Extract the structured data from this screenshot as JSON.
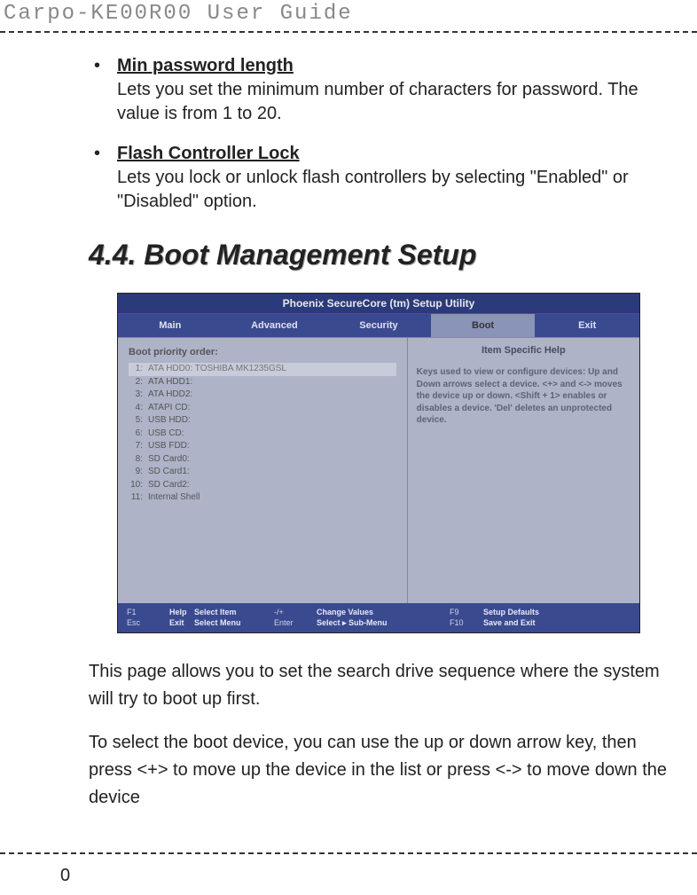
{
  "header": {
    "title": "Carpo-KE00R00 User Guide"
  },
  "bullets": [
    {
      "title": "Min password length",
      "desc": "Lets you set the minimum number of characters for password. The value is from 1 to 20."
    },
    {
      "title": "Flash Controller Lock",
      "desc": "Lets you lock or unlock flash controllers by selecting \"Enabled\" or \"Disabled\" option."
    }
  ],
  "section_heading": "4.4. Boot Management Setup",
  "bios": {
    "title": "Phoenix SecureCore (tm) Setup Utility",
    "tabs": [
      "Main",
      "Advanced",
      "Security",
      "Boot",
      "Exit"
    ],
    "active_tab_index": 3,
    "left_title": "Boot priority order:",
    "boot_items": [
      {
        "n": "1:",
        "label": "ATA HDD0: TOSHIBA MK1235GSL",
        "selected": true
      },
      {
        "n": "2:",
        "label": "ATA HDD1:",
        "selected": false
      },
      {
        "n": "3:",
        "label": "ATA HDD2:",
        "selected": false
      },
      {
        "n": "4:",
        "label": "ATAPI CD:",
        "selected": false
      },
      {
        "n": "5:",
        "label": "USB HDD:",
        "selected": false
      },
      {
        "n": "6:",
        "label": "USB CD:",
        "selected": false
      },
      {
        "n": "7:",
        "label": "USB FDD:",
        "selected": false
      },
      {
        "n": "8:",
        "label": "SD Card0:",
        "selected": false
      },
      {
        "n": "9:",
        "label": "SD Card1:",
        "selected": false
      },
      {
        "n": "10:",
        "label": "SD Card2:",
        "selected": false
      },
      {
        "n": "11:",
        "label": "Internal Shell",
        "selected": false
      }
    ],
    "help_title": "Item Specific Help",
    "help_text": "Keys used to view or configure devices:\nUp and Down arrows select a device.\n<+> and <-> moves the device up or down.\n<Shift + 1> enables or disables a device. 'Del' deletes an unprotected device.",
    "footer": {
      "r1": {
        "k1": "F1",
        "a1": "↑↓",
        "l1": "Select Item",
        "k2": "-/+",
        "l2": "Change Values",
        "k3": "F9",
        "l3": "Setup Defaults"
      },
      "r2": {
        "k1": "Esc",
        "a1": "←→",
        "l1": "Select Menu",
        "k2": "Enter",
        "l2": "Select ▸ Sub-Menu",
        "k3": "F10",
        "l3": "Save and Exit"
      },
      "r1_label": "Help",
      "r2_label": "Exit"
    }
  },
  "paras": [
    "This page allows you to set the search drive sequence where the system will try to boot up first.",
    "To select the boot device, you can use the up or down arrow key, then press <+> to move up the device in the list or press <-> to move down the device"
  ],
  "page_number": "0"
}
